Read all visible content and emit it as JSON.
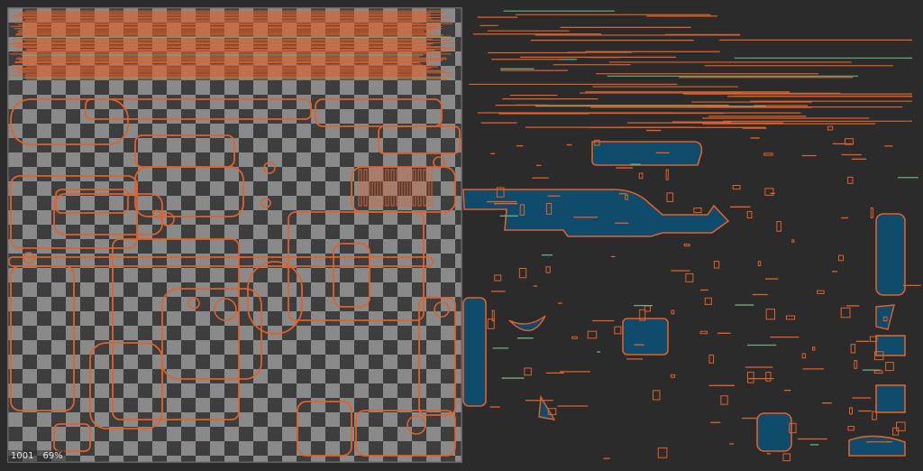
{
  "viewer": {
    "tile_id": "1001",
    "zoom": "69%"
  },
  "colors": {
    "background": "#2b2b2b",
    "checker_light": "#8a8a8a",
    "checker_dark": "#3d3d3d",
    "uv_edge": "#e0612a",
    "uv_edge_alt": "#6fae7c",
    "uv_fill_overlap": "#0f4b6a"
  },
  "icons": {
    "uv_island": "uv-island-icon"
  }
}
